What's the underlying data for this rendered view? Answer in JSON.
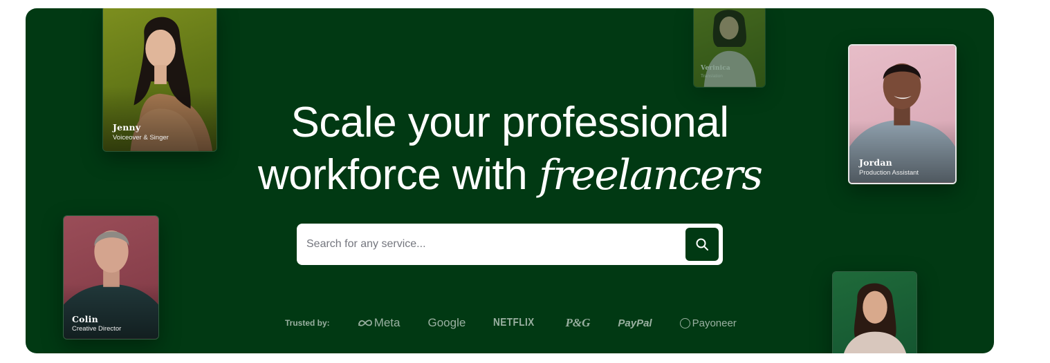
{
  "hero": {
    "headline_line1": "Scale your professional",
    "headline_line2_plain": "workforce with ",
    "headline_line2_italic": "freelancers",
    "background_color": "#013913"
  },
  "search": {
    "placeholder": "Search for any service...",
    "button_icon": "search-icon"
  },
  "trusted": {
    "label": "Trusted by:",
    "logos": [
      "Meta",
      "Google",
      "NETFLIX",
      "P&G",
      "PayPal",
      "Payoneer"
    ]
  },
  "freelancers": [
    {
      "name": "Jenny",
      "role": "Voiceover & Singer",
      "bg": "#6c8219"
    },
    {
      "name": "Verinica",
      "role": "Translation",
      "bg": "#6b7d23"
    },
    {
      "name": "Jordan",
      "role": "Production Assistant",
      "bg": "#dfb1bd"
    },
    {
      "name": "Colin",
      "role": "Creative Director",
      "bg": "#8d4450"
    }
  ]
}
